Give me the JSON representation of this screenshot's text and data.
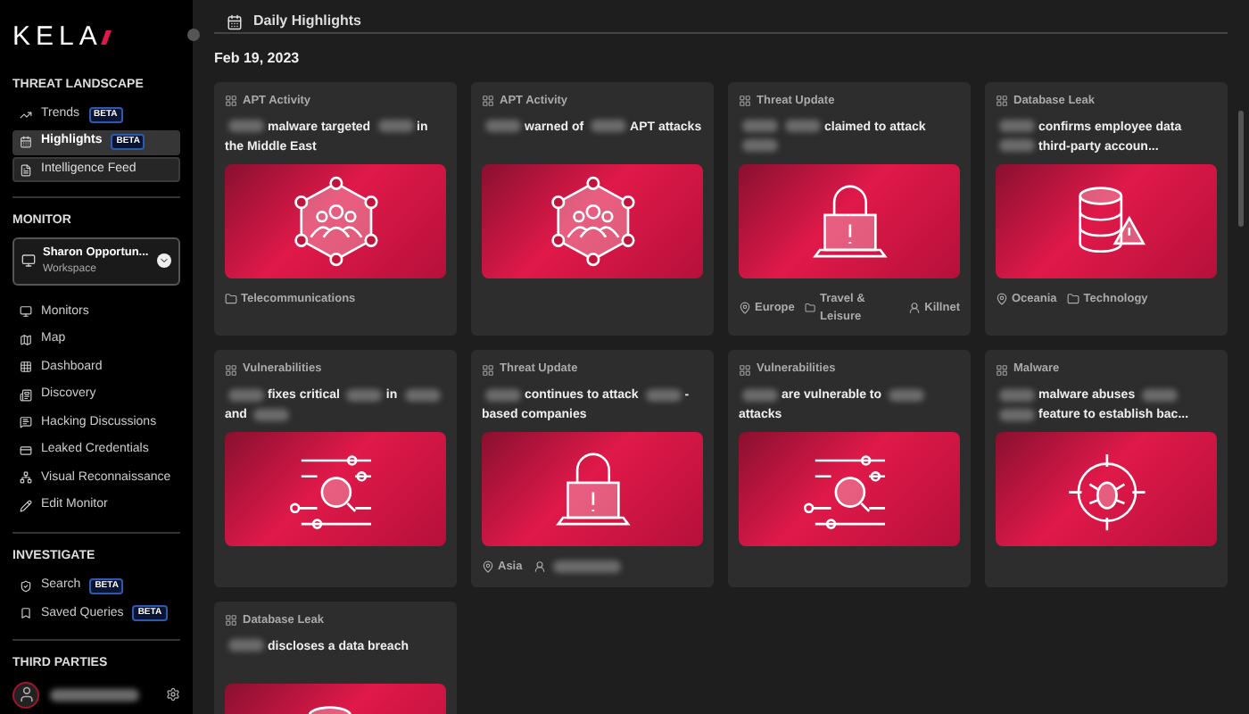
{
  "sidebar": {
    "logo": "KELA",
    "sections": [
      {
        "title": "THREAT LANDSCAPE",
        "items": [
          {
            "label": "Trends",
            "badge": "BETA",
            "selected": false,
            "hovered": false
          },
          {
            "label": "Highlights",
            "badge": "BETA",
            "selected": true,
            "hovered": false
          },
          {
            "label": "Intelligence Feed",
            "selected": false,
            "hovered": true
          }
        ]
      },
      {
        "title": "MONITOR",
        "workspace": {
          "name": "Sharon Opportun...",
          "sub": "Workspace"
        },
        "items": [
          {
            "label": "Monitors",
            "selected": false,
            "hovered": false
          },
          {
            "label": "Map",
            "selected": false,
            "hovered": false
          },
          {
            "label": "Dashboard",
            "selected": false,
            "hovered": false
          },
          {
            "label": "Discovery",
            "selected": false,
            "hovered": false
          },
          {
            "label": "Hacking Discussions",
            "selected": false,
            "hovered": false
          },
          {
            "label": "Leaked Credentials",
            "selected": false,
            "hovered": false
          },
          {
            "label": "Visual Reconnaissance",
            "selected": false,
            "hovered": false
          },
          {
            "label": "Edit Monitor",
            "selected": false,
            "hovered": false
          }
        ]
      },
      {
        "title": "INVESTIGATE",
        "items": [
          {
            "label": "Search",
            "badge": "BETA",
            "selected": false,
            "hovered": false
          },
          {
            "label": "Saved Queries",
            "badge": "BETA",
            "selected": false,
            "hovered": false
          }
        ]
      },
      {
        "title": "THIRD PARTIES"
      }
    ]
  },
  "header": {
    "title": "Daily Highlights"
  },
  "date": "Feb 19, 2023",
  "cards": [
    {
      "category": "APT Activity",
      "title": [
        {
          "kind": "redacted"
        },
        {
          "kind": "text",
          "text": "malware targeted"
        },
        {
          "kind": "redacted"
        },
        {
          "kind": "text",
          "text": "in the Middle East"
        }
      ],
      "tags": [
        {
          "kind": "industry",
          "text": "Telecommunications"
        }
      ]
    },
    {
      "category": "APT Activity",
      "title": [
        {
          "kind": "redacted"
        },
        {
          "kind": "text",
          "text": "warned of"
        },
        {
          "kind": "redacted"
        },
        {
          "kind": "text",
          "text": "APT attacks"
        }
      ]
    },
    {
      "category": "Threat Update",
      "title": [
        {
          "kind": "redacted"
        },
        {
          "kind": "redacted"
        },
        {
          "kind": "text",
          "text": "claimed to attack"
        },
        {
          "kind": "redacted"
        }
      ],
      "tags": [
        {
          "kind": "location",
          "text": "Europe"
        },
        {
          "kind": "industry",
          "text": "Travel & Leisure"
        },
        {
          "kind": "actor",
          "text": "Killnet"
        }
      ]
    },
    {
      "category": "Database Leak",
      "title": [
        {
          "kind": "redacted"
        },
        {
          "kind": "text",
          "text": "confirms employee data"
        },
        {
          "kind": "redacted"
        },
        {
          "kind": "text",
          "text": "third-party accoun..."
        }
      ],
      "tags": [
        {
          "kind": "location",
          "text": "Oceania"
        },
        {
          "kind": "industry",
          "text": "Technology"
        }
      ]
    },
    {
      "category": "Vulnerabilities",
      "title": [
        {
          "kind": "redacted"
        },
        {
          "kind": "text",
          "text": "fixes critical"
        },
        {
          "kind": "redacted"
        },
        {
          "kind": "text",
          "text": "in"
        },
        {
          "kind": "redacted"
        },
        {
          "kind": "text",
          "text": "and"
        },
        {
          "kind": "redacted"
        }
      ]
    },
    {
      "category": "Threat Update",
      "title": [
        {
          "kind": "redacted"
        },
        {
          "kind": "text",
          "text": "continues to attack"
        },
        {
          "kind": "redacted"
        },
        {
          "kind": "text",
          "text": "-based companies"
        }
      ],
      "tags": [
        {
          "kind": "location",
          "text": "Asia"
        },
        {
          "kind": "actor_redacted"
        }
      ]
    },
    {
      "category": "Vulnerabilities",
      "title": [
        {
          "kind": "redacted"
        },
        {
          "kind": "text",
          "text": "are vulnerable to"
        },
        {
          "kind": "redacted"
        },
        {
          "kind": "text",
          "text": "attacks"
        }
      ]
    },
    {
      "category": "Malware",
      "title": [
        {
          "kind": "redacted"
        },
        {
          "kind": "text",
          "text": "malware abuses"
        },
        {
          "kind": "redacted"
        },
        {
          "kind": "redacted"
        },
        {
          "kind": "text",
          "text": "feature to establish bac..."
        }
      ]
    },
    {
      "category": "Database Leak",
      "title": [
        {
          "kind": "redacted"
        },
        {
          "kind": "text",
          "text": "discloses a data breach"
        }
      ]
    }
  ]
}
